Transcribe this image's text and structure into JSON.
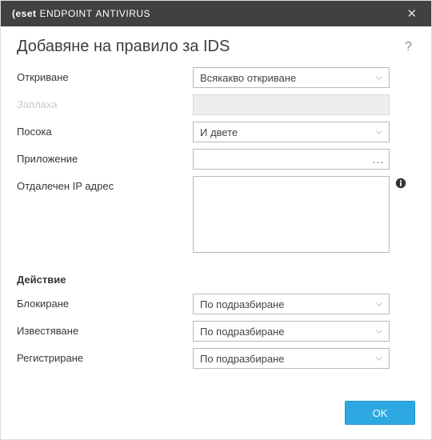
{
  "titlebar": {
    "brand": "(eset",
    "product1": "ENDPOINT",
    "product2": "ANTIVIRUS"
  },
  "header": {
    "title": "Добавяне на правило за IDS"
  },
  "fields": {
    "detection": {
      "label": "Откриване",
      "value": "Всякакво откриване"
    },
    "threat": {
      "label": "Заплаха",
      "value": ""
    },
    "direction": {
      "label": "Посока",
      "value": "И двете"
    },
    "application": {
      "label": "Приложение",
      "value": ""
    },
    "remote_ip": {
      "label": "Отдалечен IP адрес",
      "value": ""
    }
  },
  "action": {
    "section": "Действие",
    "block": {
      "label": "Блокиране",
      "value": "По подразбиране"
    },
    "notify": {
      "label": "Известяване",
      "value": "По подразбиране"
    },
    "log": {
      "label": "Регистриране",
      "value": "По подразбиране"
    }
  },
  "buttons": {
    "ok": "OK"
  }
}
